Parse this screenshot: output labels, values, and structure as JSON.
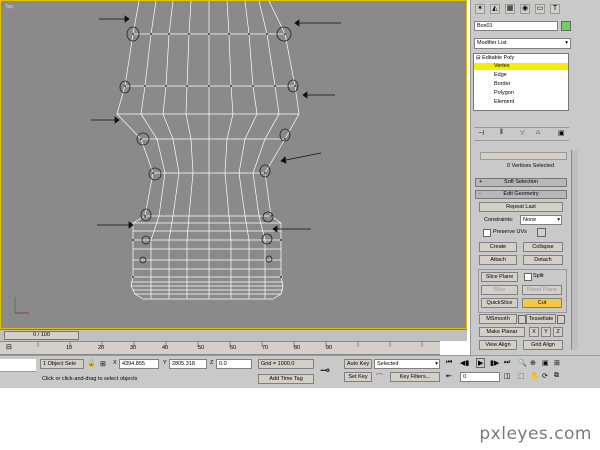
{
  "viewport": {
    "label": "Top"
  },
  "panel": {
    "object_name": "Box01",
    "modifier_list": "Modifier List",
    "stack": [
      "Editable Poly",
      "Vertex",
      "Edge",
      "Border",
      "Polygon",
      "Element"
    ],
    "selection_status": "0 Vertices Selected",
    "rollout_soft_selection": "Soft Selection",
    "rollout_edit_geometry": "Edit Geometry",
    "repeat_last": "Repeat Last",
    "constraints_label": "Constraints:",
    "constraints_value": "None",
    "preserve_uvs": "Preserve UVs",
    "create": "Create",
    "collapse": "Collapse",
    "attach": "Attach",
    "detach": "Detach",
    "slice_plane": "Slice Plane",
    "split": "Split",
    "slice": "Slice",
    "reset_plane": "Reset Plane",
    "quickslice": "QuickSlice",
    "cut": "Cut",
    "msmooth": "MSmooth",
    "tessellate": "Tessellate",
    "make_planar": "Make Planar",
    "view_align": "View Align",
    "grid_align": "Grid Align",
    "plus": "+",
    "minus": "-"
  },
  "timeline": {
    "frame": "0 / 100",
    "ticks": [
      "10",
      "20",
      "30",
      "40",
      "50",
      "60",
      "70",
      "80",
      "90"
    ]
  },
  "status": {
    "object_sel": "1 Object Sele",
    "x_label": "X",
    "x_value": "4394.855",
    "y_label": "Y",
    "y_value": "2805.318",
    "z_label": "Z",
    "z_value": "0.0",
    "grid": "Grid = 1000.0",
    "prompt": "Click or click-and-drag to select objects",
    "add_time_tag": "Add Time Tag",
    "auto_key": "Auto Key",
    "selected": "Selected",
    "set_key": "Set Key",
    "key_filters": "Key Filters...",
    "frame_field": "0"
  },
  "watermark": "pxleyes.com",
  "colors": {
    "highlight": "#f5c842",
    "wire": "#ffffff",
    "vertex": "#3a3aa0"
  }
}
